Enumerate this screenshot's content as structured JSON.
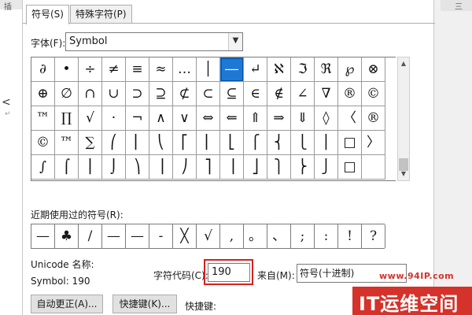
{
  "tabs": [
    "符号(S)",
    "特殊字符(P)"
  ],
  "font": {
    "label": "字体(F):",
    "value": "Symbol"
  },
  "symbol_grid": [
    [
      "∂",
      "•",
      "÷",
      "≠",
      "≡",
      "≈",
      "…",
      "│",
      "―",
      "↵",
      "ℵ",
      "ℑ",
      "ℜ",
      "℘",
      "⊗"
    ],
    [
      "⊕",
      "∅",
      "∩",
      "∪",
      "⊃",
      "⊇",
      "⊄",
      "⊂",
      "⊆",
      "∈",
      "∉",
      "∠",
      "∇",
      "®",
      "©"
    ],
    [
      "™",
      "∏",
      "√",
      "·",
      "¬",
      "∧",
      "∨",
      "⇔",
      "⇐",
      "⇑",
      "⇒",
      "⇓",
      "◊",
      "〈",
      "®"
    ],
    [
      "©",
      "™",
      "∑",
      "⎛",
      "⎜",
      "⎝",
      "⎡",
      "⎢",
      "⎣",
      "⎧",
      "⎨",
      "⎩",
      "⎪",
      "□",
      "〉"
    ],
    [
      "∫",
      "⌠",
      "⎮",
      "⌡",
      "⎞",
      "⎟",
      "⎠",
      "⎤",
      "⎥",
      "⎦",
      "⎫",
      "⎬",
      "⎭",
      "□",
      ""
    ]
  ],
  "selected_symbol": "―",
  "recent": {
    "label": "近期使用过的符号(R):",
    "symbols": [
      "—",
      "♣",
      "/",
      "—",
      "—",
      "-",
      "╳",
      "√",
      ",",
      "。",
      "、",
      ";",
      ":",
      "!",
      "?"
    ]
  },
  "unicode_label": "Unicode 名称:",
  "symbol_code": "Symbol: 190",
  "char_code": {
    "label": "字符代码(C):",
    "value": "190"
  },
  "from": {
    "label": "来自(M):",
    "value": "符号(十进制)"
  },
  "buttons": {
    "autocorrect": "自动更正(A)...",
    "shortcut": "快捷键(K)..."
  },
  "shortcut_label": "快捷键:",
  "watermark": {
    "url": "www.94IP.com",
    "logo_text": "IT运维空间"
  },
  "background": {
    "left_mark": "插",
    "right_mark": "三"
  },
  "colors": {
    "selection": "#1e78d6",
    "highlight": "#d62020",
    "watermark": "#d4322a"
  }
}
